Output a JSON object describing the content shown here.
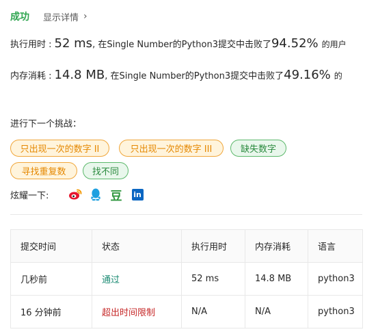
{
  "result": {
    "status": "成功",
    "details_link": "显示详情"
  },
  "runtime": {
    "label": "执行用时 :",
    "value": "52 ms",
    "middle": ", 在Single Number的Python3提交中击败了",
    "percent": "94.52%",
    "suffix": "的用户"
  },
  "memory": {
    "label": "内存消耗 :",
    "value": "14.8 MB",
    "middle": ", 在Single Number的Python3提交中击败了",
    "percent": "49.16%",
    "suffix": "的"
  },
  "challenges": {
    "label": "进行下一个挑战：",
    "tags": [
      {
        "label": "只出现一次的数字 II",
        "difficulty": "medium"
      },
      {
        "label": "只出现一次的数字 III",
        "difficulty": "medium"
      },
      {
        "label": "缺失数字",
        "difficulty": "easy"
      },
      {
        "label": "寻找重复数",
        "difficulty": "medium"
      },
      {
        "label": "找不同",
        "difficulty": "easy"
      }
    ]
  },
  "share": {
    "label": "炫耀一下:",
    "icons": [
      "weibo-icon",
      "qq-icon",
      "douban-icon",
      "linkedin-icon"
    ],
    "douban_glyph": "豆",
    "linkedin_glyph": "in"
  },
  "table": {
    "headers": [
      "提交时间",
      "状态",
      "执行用时",
      "内存消耗",
      "语言"
    ],
    "rows": [
      {
        "time": "几秒前",
        "status": "通过",
        "runtime": "52 ms",
        "memory": "14.8 MB",
        "language": "python3"
      },
      {
        "time": "16 分钟前",
        "status": "超出时间限制",
        "runtime": "N/A",
        "memory": "N/A",
        "language": "python3"
      }
    ]
  },
  "colors": {
    "success": "#2da44e",
    "accepted": "#1a8a72",
    "time_limit": "#c62828",
    "medium_tag": "#e58700",
    "easy_tag": "#2a8a3e"
  }
}
